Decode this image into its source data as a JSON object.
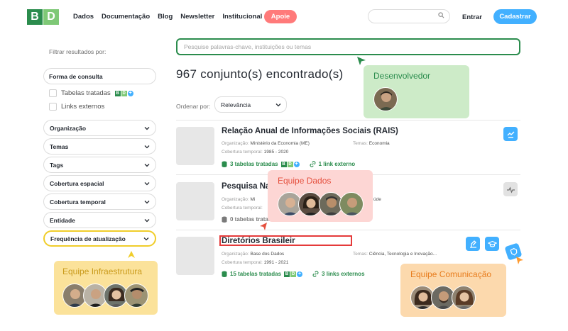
{
  "header": {
    "logo": {
      "left": "B",
      "right": "D"
    },
    "nav": [
      "Dados",
      "Documentação",
      "Blog",
      "Newsletter",
      "Institucional"
    ],
    "apoie": "Apoie",
    "entrar": "Entrar",
    "cadastrar": "Cadastrar"
  },
  "sidebar": {
    "label": "Filtrar resultados por:",
    "forma": "Forma de consulta",
    "checks": [
      "Tabelas tratadas",
      "Links externos"
    ],
    "filters": [
      "Organização",
      "Temas",
      "Tags",
      "Cobertura espacial",
      "Cobertura temporal",
      "Entidade",
      "Frequência de atualização"
    ]
  },
  "main": {
    "search_placeholder": "Pesquise palavras-chave, instituições ou temas",
    "count": "967 conjunto(s) encontrado(s)",
    "order_label": "Ordenar por:",
    "order_value": "Relevância",
    "results": [
      {
        "title": "Relação Anual de Informações Sociais (RAIS)",
        "org_label": "Organização:",
        "org": "Ministério da Economia (ME)",
        "tema_label": "Temas:",
        "tema": "Economia",
        "cov_label": "Cobertura temporal:",
        "cov": "1985 - 2020",
        "tables": "3 tabelas tratadas",
        "links": "1 link externo"
      },
      {
        "title": "Pesquisa Nac",
        "org_label": "Organização:",
        "org": "Mi",
        "tema_label": "",
        "tema": "úde",
        "cov_label": "Cobertura temporal:",
        "cov": "",
        "tables": "0 tabelas tratadas",
        "links": ""
      },
      {
        "title": "Diretórios Brasileir",
        "org_label": "Organização:",
        "org": "Base dos Dados",
        "tema_label": "Temas:",
        "tema": "Ciência, Tecnologia e Inovação...",
        "cov_label": "Cobertura temporal:",
        "cov": "1991 - 2021",
        "tables": "15 tabelas tratadas",
        "links": "3 links externos"
      }
    ]
  },
  "cards": {
    "dev": "Desenvolvedor",
    "dados": "Equipe Dados",
    "infra": "Equipe Infraestrutura",
    "comm": "Equipe Comunicação"
  },
  "colors": {
    "green": "#2b8c4d",
    "blue": "#42b0ff",
    "pink": "#ff7a7a",
    "dev_card": "#cdebc8",
    "dados_card": "#fdd6d4",
    "infra_card": "#fbe29a",
    "comm_card": "#fcd9ad"
  }
}
